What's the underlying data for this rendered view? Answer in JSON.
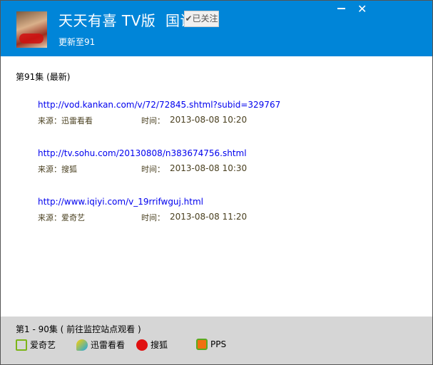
{
  "header": {
    "title": "天天有喜 TV版  国语",
    "follow_label": "✔已关注",
    "subtitle": "更新至91"
  },
  "window": {
    "minimize": "−",
    "close": "✕"
  },
  "episode": {
    "heading": "第91集 (最新)",
    "links": [
      {
        "url": "http://vod.kankan.com/v/72/72845.shtml?subid=329767",
        "source_label": "来源：迅雷看看",
        "time_label": "时间：",
        "time": "2013-08-08 10:20"
      },
      {
        "url": "http://tv.sohu.com/20130808/n383674756.shtml",
        "source_label": "来源：搜狐",
        "time_label": "时间：",
        "time": "2013-08-08 10:30"
      },
      {
        "url": "http://www.iqiyi.com/v_19rrifwguj.html",
        "source_label": "来源：爱奇艺",
        "time_label": "时间：",
        "time": "2013-08-08 11:20"
      }
    ]
  },
  "footer": {
    "range": "第1 - 90集 ( 前往监控站点观看 )",
    "sites": [
      {
        "label": "爱奇艺",
        "icon": "iqiyi-icon",
        "color": "#7cb518"
      },
      {
        "label": "迅雷看看",
        "icon": "kankan-icon",
        "color": "#1aa6e8"
      },
      {
        "label": "搜狐",
        "icon": "sohu-icon",
        "color": "#e01010"
      },
      {
        "label": "PPS",
        "icon": "pps-icon",
        "color": "#5aaa20"
      }
    ]
  },
  "colors": {
    "header": "#0085d8",
    "link": "#0000ee",
    "footer": "#d6d6d6"
  }
}
